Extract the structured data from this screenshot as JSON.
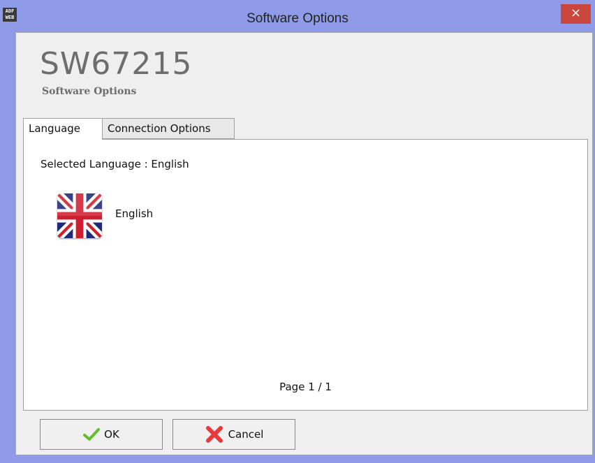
{
  "window": {
    "title": "Software Options",
    "app_icon_text": "ADF WEB",
    "close_glyph": "×"
  },
  "header": {
    "code": "SW67215",
    "subtitle": "Software Options"
  },
  "tabs": [
    {
      "label": "Language",
      "active": true
    },
    {
      "label": "Connection Options",
      "active": false
    }
  ],
  "language_panel": {
    "selected_text": "Selected Language : English",
    "languages": [
      {
        "label": "English",
        "icon": "uk-flag-icon"
      }
    ],
    "page_info": "Page 1 / 1"
  },
  "buttons": {
    "ok_label": "OK",
    "ok_icon": "check-icon",
    "cancel_label": "Cancel",
    "cancel_icon": "cross-icon"
  },
  "colors": {
    "frame": "#8f9be8",
    "close": "#c9473c",
    "check": "#5fbf2f",
    "cross": "#e83a3a"
  }
}
